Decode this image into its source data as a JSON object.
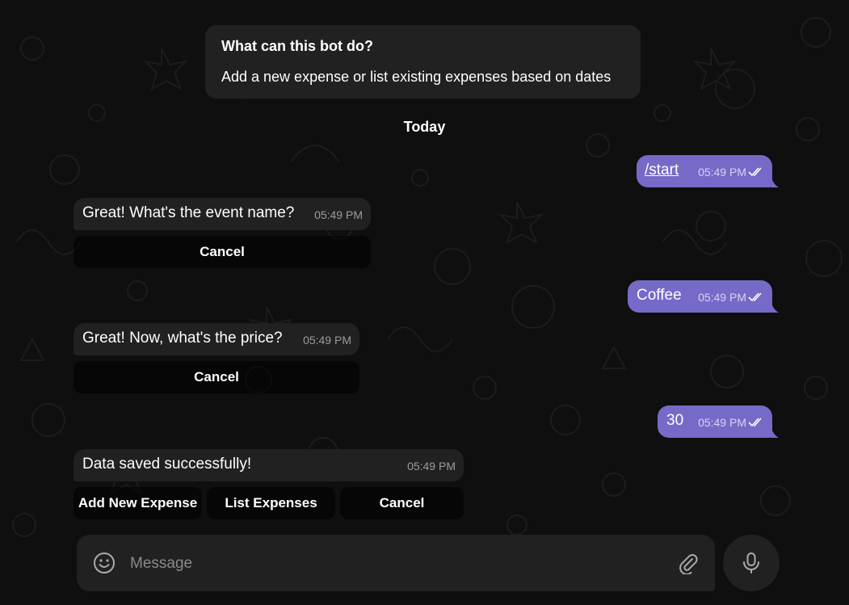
{
  "bot_info": {
    "title": "What can this bot do?",
    "description": "Add a new expense or list existing expenses based on dates"
  },
  "date_separator": "Today",
  "messages": [
    {
      "direction": "out",
      "text": "/start",
      "time": "05:49 PM"
    },
    {
      "direction": "in",
      "text": "Great! What's the event name?",
      "time": "05:49 PM",
      "buttons": [
        "Cancel"
      ]
    },
    {
      "direction": "out",
      "text": "Coffee",
      "time": "05:49 PM"
    },
    {
      "direction": "in",
      "text": "Great! Now, what's the price?",
      "time": "05:49 PM",
      "buttons": [
        "Cancel"
      ]
    },
    {
      "direction": "out",
      "text": "30",
      "time": "05:49 PM"
    },
    {
      "direction": "in",
      "text": "Data saved successfully!",
      "time": "05:49 PM",
      "buttons": [
        "Add New Expense",
        "List Expenses",
        "Cancel"
      ]
    }
  ],
  "composer": {
    "placeholder": "Message"
  },
  "icons": {
    "emoji": "smile-icon",
    "attach": "paperclip-icon",
    "mic": "microphone-icon",
    "read": "double-check-icon"
  },
  "colors": {
    "background": "#0f0f0f",
    "incoming_bubble": "#212121",
    "outgoing_bubble": "#766ac8",
    "accent": "#8774e1"
  }
}
